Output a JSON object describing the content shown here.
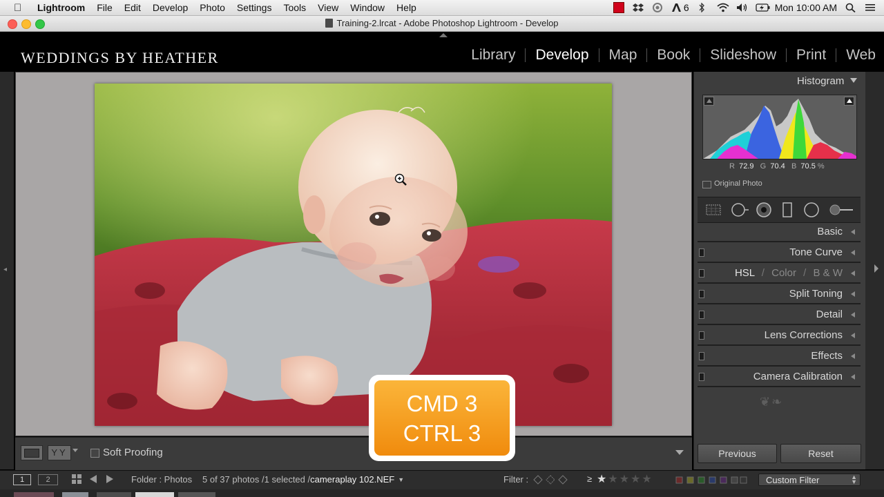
{
  "menubar": {
    "app": "Lightroom",
    "items": [
      "File",
      "Edit",
      "Develop",
      "Photo",
      "Settings",
      "Tools",
      "View",
      "Window",
      "Help"
    ],
    "status": {
      "adobe_badge": "6",
      "clock": "Mon 10:00 AM"
    }
  },
  "window": {
    "title": "Training-2.lrcat - Adobe Photoshop Lightroom - Develop"
  },
  "identity_plate": "WEDDINGS BY HEATHER",
  "modules": [
    {
      "label": "Library",
      "active": false
    },
    {
      "label": "Develop",
      "active": true
    },
    {
      "label": "Map",
      "active": false
    },
    {
      "label": "Book",
      "active": false
    },
    {
      "label": "Slideshow",
      "active": false
    },
    {
      "label": "Print",
      "active": false
    },
    {
      "label": "Web",
      "active": false
    }
  ],
  "toolbar": {
    "soft_proofing": "Soft Proofing"
  },
  "right_panel": {
    "histogram_title": "Histogram",
    "rgb": {
      "r_label": "R",
      "r": "72.9",
      "g_label": "G",
      "g": "70.4",
      "b_label": "B",
      "b": "70.5",
      "unit": "%"
    },
    "original_photo": "Original Photo",
    "panels": {
      "basic": "Basic",
      "tone_curve": "Tone Curve",
      "hsl": "HSL",
      "hsl_slash1": "/",
      "color": "Color",
      "hsl_slash2": "/",
      "bw": "B & W",
      "split_toning": "Split Toning",
      "detail": "Detail",
      "lens_corrections": "Lens Corrections",
      "effects": "Effects",
      "camera_calibration": "Camera Calibration"
    },
    "previous_button": "Previous",
    "reset_button": "Reset"
  },
  "filmbar": {
    "view1": "1",
    "view2": "2",
    "folder": "Folder : Photos",
    "count": "5 of 37 photos /1 selected /",
    "filename": "cameraplay 102.NEF",
    "filter_label": "Filter :",
    "rating_op": "≥",
    "custom_filter": "Custom Filter"
  },
  "overlay": {
    "line1": "CMD 3",
    "line2": "CTRL 3"
  },
  "colors": {
    "accent_orange": "#f39a1c",
    "panel_bg": "#3d3d3d",
    "canvas_bg": "#a9a6a6"
  }
}
